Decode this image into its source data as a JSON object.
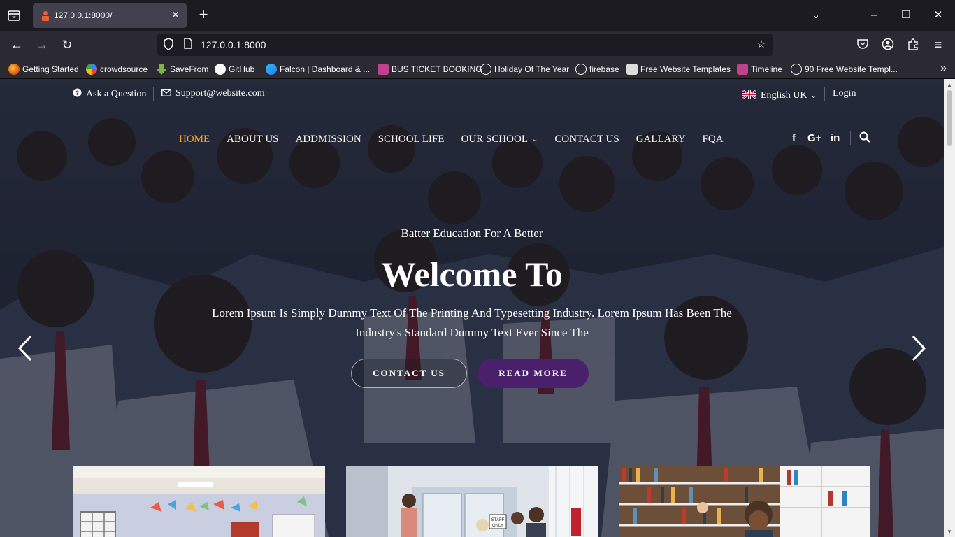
{
  "browser": {
    "tab_title": "127.0.0.1:8000/",
    "url": "127.0.0.1:8000",
    "bookmarks": [
      {
        "label": "Getting Started",
        "icon": "firefox-icon",
        "color": "#e66000"
      },
      {
        "label": "crowdsource",
        "icon": "crowdsource-icon",
        "color": "#4285f4"
      },
      {
        "label": "SaveFrom",
        "icon": "savefrom-icon",
        "color": "#7cb342"
      },
      {
        "label": "GitHub",
        "icon": "github-icon",
        "color": "#ffffff"
      },
      {
        "label": "Falcon | Dashboard & ...",
        "icon": "falcon-icon",
        "color": "#2c7be5"
      },
      {
        "label": "BUS TICKET BOOKING",
        "icon": "bus-icon",
        "color": "#c2418c"
      },
      {
        "label": "Holiday Of The Year",
        "icon": "globe-icon",
        "color": "#fbfbfe"
      },
      {
        "label": "firebase",
        "icon": "globe-icon",
        "color": "#fbfbfe"
      },
      {
        "label": "Free Website Templates",
        "icon": "ost-icon",
        "color": "#dddddd"
      },
      {
        "label": "Timeline",
        "icon": "timeline-icon",
        "color": "#c2418c"
      },
      {
        "label": "90 Free Website Templ...",
        "icon": "globe-icon",
        "color": "#fbfbfe"
      }
    ]
  },
  "topbar": {
    "ask": "Ask a Question",
    "support": "Support@website.com",
    "language": "English UK",
    "login": "Login"
  },
  "nav": {
    "items": [
      "HOME",
      "ABOUT US",
      "ADDMISSION",
      "SCHOOL LIFE",
      "OUR SCHOOL",
      "CONTACT US",
      "GALLARY",
      "FQA"
    ],
    "active": "HOME",
    "active_color": "#f5a623"
  },
  "social": {
    "facebook": "f",
    "google": "G+",
    "linkedin": "in"
  },
  "hero": {
    "subtitle": "Batter Education For A Better",
    "title": "Welcome To",
    "text": "Lorem Ipsum Is Simply Dummy Text Of The Printing And Typesetting Industry. Lorem Ipsum Has Been The Industry's Standard Dummy Text Ever Since The",
    "btn_contact": "CONTACT US",
    "btn_read": "READ MORE",
    "accent_color": "#4a1f6b"
  }
}
